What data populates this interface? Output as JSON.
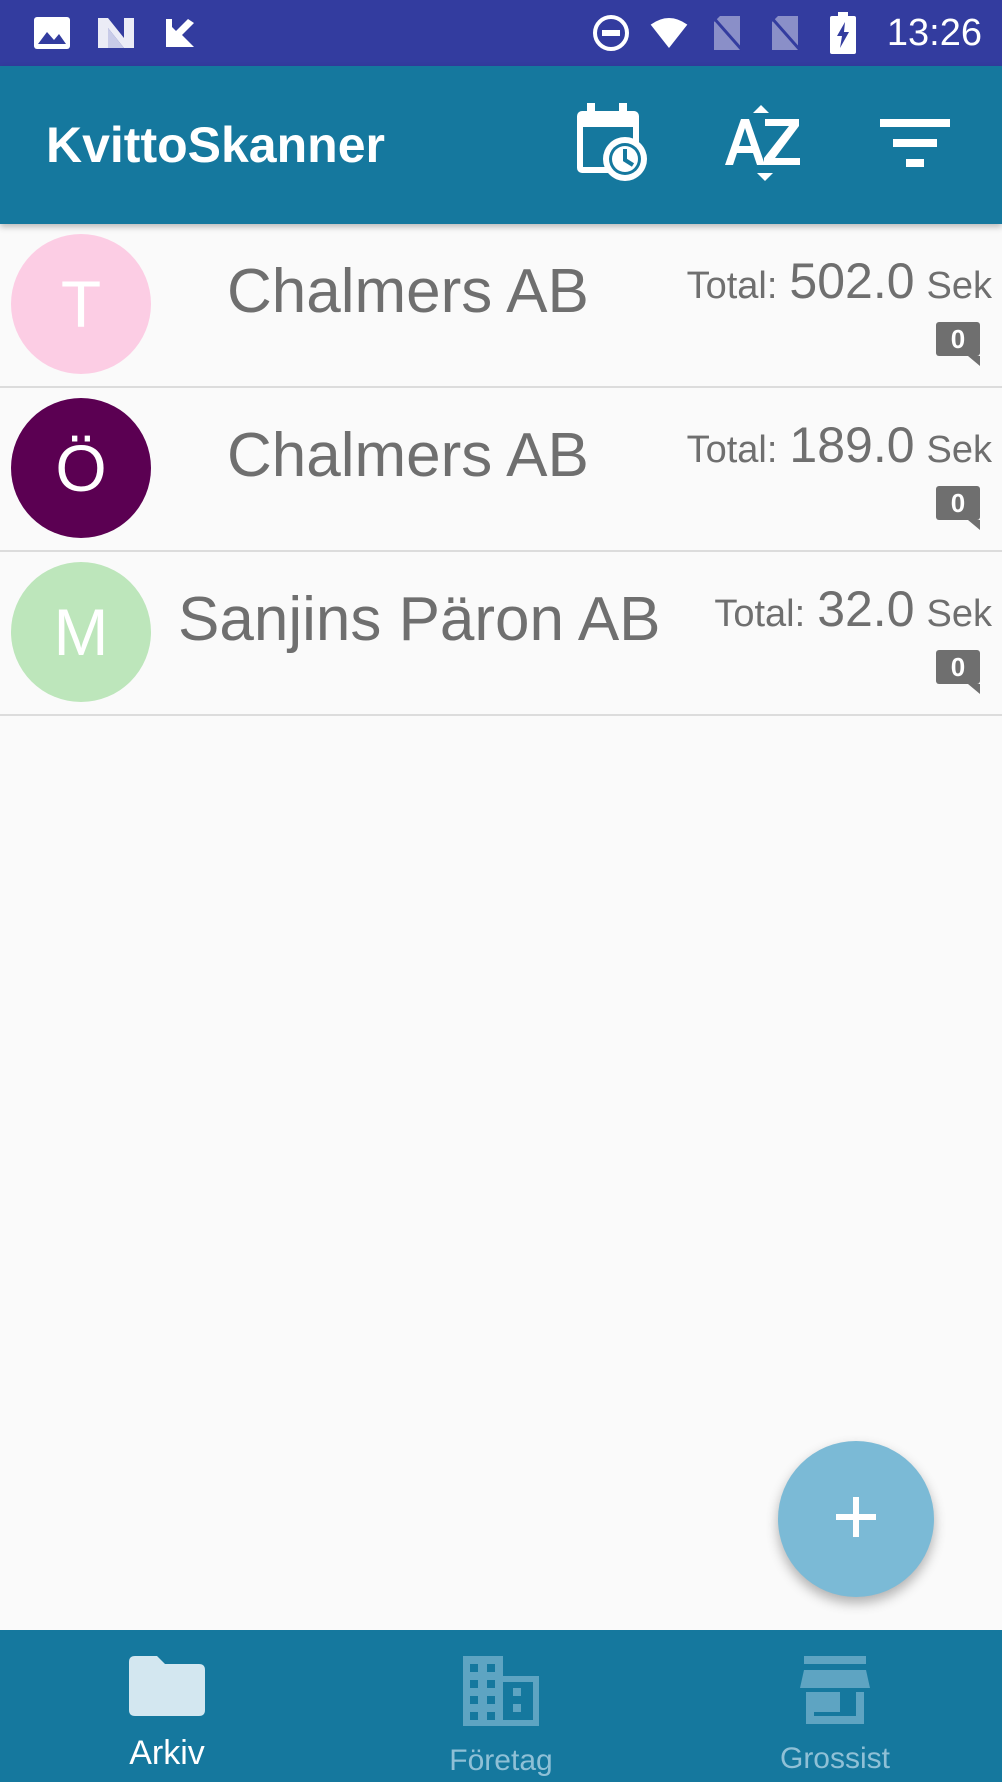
{
  "status_bar": {
    "time": "13:26",
    "left_icons": [
      "image-icon",
      "n-logo-icon",
      "check-badge-icon"
    ],
    "right_icons": [
      "do-not-disturb-icon",
      "wifi-icon",
      "no-sim-icon",
      "no-sim-icon",
      "battery-charging-icon"
    ]
  },
  "app_bar": {
    "title": "KvittoSkanner",
    "actions": [
      "calendar-clock-icon",
      "sort-az-icon",
      "filter-icon"
    ],
    "color": "#15789e"
  },
  "receipts": [
    {
      "avatar_letter": "T",
      "avatar_color": "#fccde4",
      "company": "Chalmers AB",
      "total_label": "Total:",
      "total_value": "502.0",
      "currency": "Sek",
      "comments": "0"
    },
    {
      "avatar_letter": "Ö",
      "avatar_color": "#5b0052",
      "company": "Chalmers AB",
      "total_label": "Total:",
      "total_value": "189.0",
      "currency": "Sek",
      "comments": "0"
    },
    {
      "avatar_letter": "M",
      "avatar_color": "#bde6bb",
      "company": "Sanjins Päron AB",
      "total_label": "Total:",
      "total_value": "32.0",
      "currency": "Sek",
      "comments": "0"
    }
  ],
  "fab": {
    "icon": "plus-icon",
    "symbol": "+"
  },
  "bottom_nav": [
    {
      "label": "Arkiv",
      "icon": "folder-icon",
      "active": true
    },
    {
      "label": "Företag",
      "icon": "building-icon",
      "active": false
    },
    {
      "label": "Grossist",
      "icon": "store-icon",
      "active": false
    }
  ]
}
